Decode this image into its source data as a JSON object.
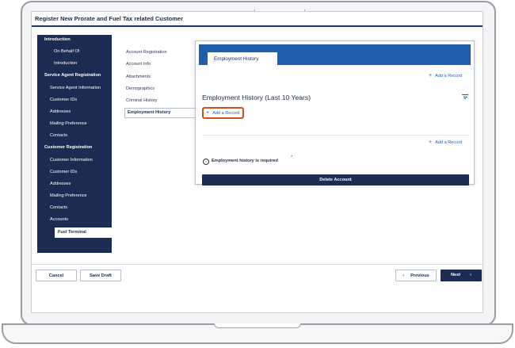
{
  "page": {
    "title": "Register New Prorate and Fuel Tax related Customer"
  },
  "sidebar": {
    "items": [
      {
        "label": "Introduction",
        "kind": "head"
      },
      {
        "label": "On Behalf Of",
        "kind": "sub"
      },
      {
        "label": "Introduction",
        "kind": "sub"
      },
      {
        "label": "Service Agent Registration",
        "kind": "head"
      },
      {
        "label": "Service Agent Information",
        "kind": "sub"
      },
      {
        "label": "Customer IDs",
        "kind": "sub"
      },
      {
        "label": "Addresses",
        "kind": "sub"
      },
      {
        "label": "Mailing Preference",
        "kind": "sub"
      },
      {
        "label": "Contacts",
        "kind": "sub"
      },
      {
        "label": "Customer Registration",
        "kind": "head"
      },
      {
        "label": "Customer Information",
        "kind": "sub"
      },
      {
        "label": "Customer IDs",
        "kind": "sub"
      },
      {
        "label": "Addresses",
        "kind": "sub"
      },
      {
        "label": "Mailing Preference",
        "kind": "sub"
      },
      {
        "label": "Contacts",
        "kind": "sub"
      },
      {
        "label": "Accounts",
        "kind": "sub"
      },
      {
        "label": "Fuel Terminal",
        "kind": "active"
      }
    ]
  },
  "subnav": {
    "items": [
      {
        "label": "Account Registration"
      },
      {
        "label": "Account Info"
      },
      {
        "label": "Attachments"
      },
      {
        "label": "Demographics"
      },
      {
        "label": "Criminal History"
      }
    ],
    "active_label": "Employment History"
  },
  "card": {
    "tab_label": "Employment History",
    "add_record_label": "Add a Record",
    "section_title": "Employment History (Last 10 Years)",
    "required_message": "Employment history is required",
    "required_marker": "*",
    "delete_label": "Delete Account",
    "info_glyph": "i",
    "plus_glyph": "+"
  },
  "footer": {
    "cancel_label": "Cancel",
    "save_draft_label": "Save Draft",
    "previous_label": "Previous",
    "next_label": "Next",
    "prev_glyph": "‹",
    "next_glyph": "›"
  },
  "colors": {
    "navy": "#1b2b52",
    "accent_blue": "#1f5fae",
    "highlight_orange": "#c9531a",
    "required_red": "#d32f2f"
  },
  "icons": [
    "plus-icon",
    "filter-icon",
    "info-icon",
    "chevron-left-icon",
    "chevron-right-icon"
  ]
}
